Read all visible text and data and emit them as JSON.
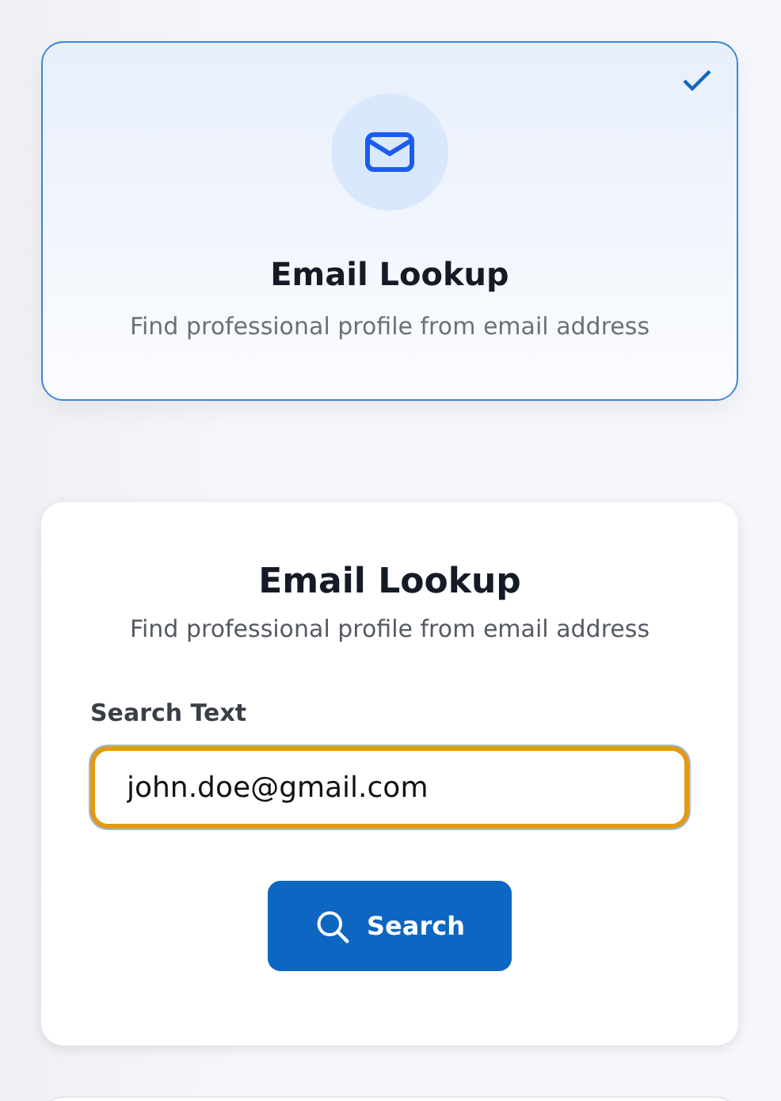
{
  "option_card": {
    "title": "Email Lookup",
    "description": "Find professional profile from email address",
    "selected": true
  },
  "form": {
    "title": "Email Lookup",
    "description": "Find professional profile from email address",
    "field_label": "Search Text",
    "value": "john.doe@gmail.com",
    "button": "Search"
  }
}
